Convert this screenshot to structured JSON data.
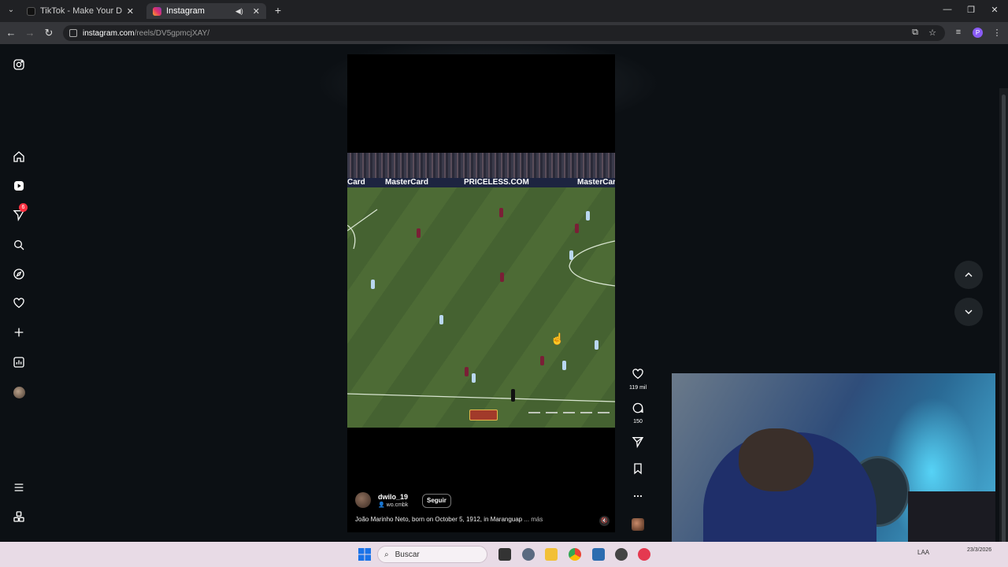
{
  "browser": {
    "tabs": [
      {
        "title": "TikTok - Make Your Day",
        "active": false
      },
      {
        "title": "Instagram",
        "active": true
      }
    ],
    "url_host": "instagram.com",
    "url_path": "/reels/DV5gpmcjXAY/"
  },
  "sidebar": {
    "notifications_badge": "6",
    "items": [
      "instagram-logo-icon",
      "home-icon",
      "reels-icon",
      "messages-icon",
      "search-icon",
      "explore-icon",
      "notifications-icon",
      "create-icon",
      "dashboard-icon",
      "profile-avatar",
      "menu-icon",
      "threads-icon"
    ]
  },
  "video": {
    "boards": [
      "Card",
      "MasterCard",
      "PRICELESS.COM",
      "MasterCard"
    ]
  },
  "reel": {
    "author": "dwilo_19",
    "audio": "wo.cmbk",
    "follow_label": "Seguir",
    "caption": "João Marinho Neto, born on October 5, 1912, in Maranguap",
    "more": "... más"
  },
  "actions": {
    "likes": "119 mil",
    "comments": "150"
  },
  "taskbar": {
    "search_label": "Buscar",
    "tray_lang": "LAA",
    "date": "23/3/2026"
  },
  "colors": {
    "page_bg": "#0c1014",
    "badge": "#ff3040",
    "taskbar": "#e8dbe6"
  }
}
